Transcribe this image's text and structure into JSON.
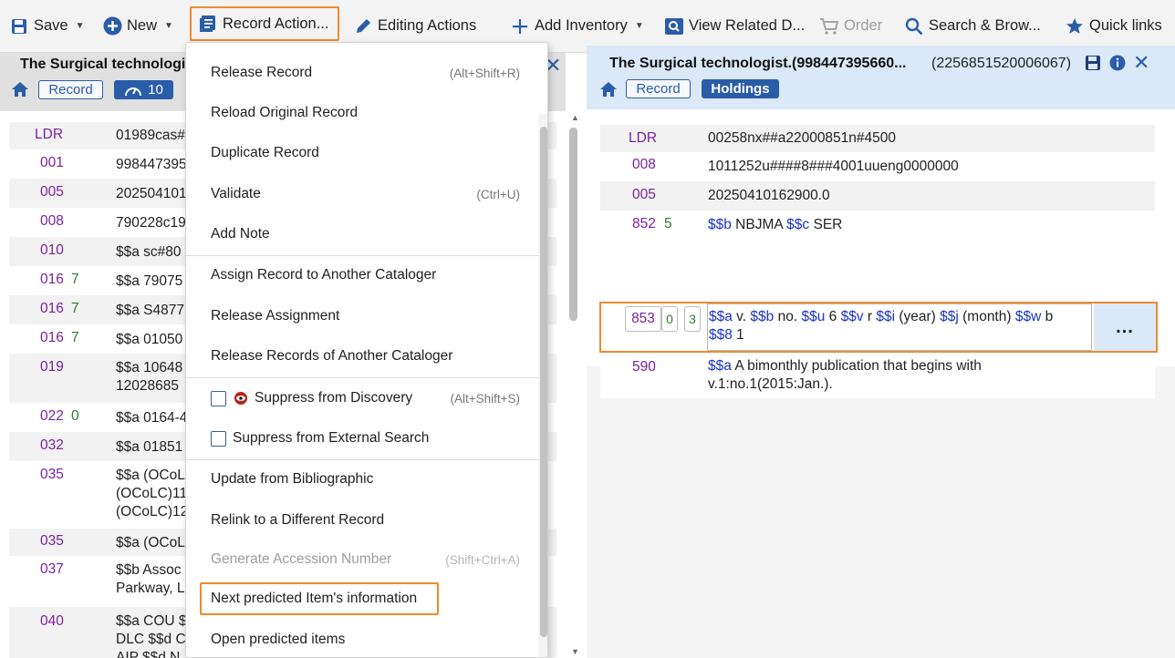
{
  "toolbar": {
    "save": "Save",
    "new": "New",
    "record_action": "Record Action...",
    "editing_actions": "Editing Actions",
    "add_inventory": "Add Inventory",
    "view_related": "View Related D...",
    "order": "Order",
    "search_browse": "Search & Brow...",
    "quick_links": "Quick links"
  },
  "left": {
    "title": "The Surgical technologis",
    "record_pill": "Record",
    "count_badge": "10",
    "fields": [
      {
        "tag": "LDR",
        "ind": "",
        "value": "01989cas#"
      },
      {
        "tag": "001",
        "ind": "",
        "value": "998447395"
      },
      {
        "tag": "005",
        "ind": "",
        "value": "202504101"
      },
      {
        "tag": "008",
        "ind": "",
        "value": "790228c19"
      },
      {
        "tag": "010",
        "ind": "",
        "value": "$$a sc#80"
      },
      {
        "tag": "016",
        "ind": "7",
        "value": "$$a 79075"
      },
      {
        "tag": "016",
        "ind": "7",
        "value": "$$a S4877"
      },
      {
        "tag": "016",
        "ind": "7",
        "value": "$$a 01050"
      },
      {
        "tag": "019",
        "ind": "",
        "value": "$$a 10648",
        "value2": "12028685"
      },
      {
        "tag": "022",
        "ind": "0",
        "value": "$$a 0164-4"
      },
      {
        "tag": "032",
        "ind": "",
        "value": "$$a 01851"
      },
      {
        "tag": "035",
        "ind": "",
        "value": "$$a (OCoL",
        "value2": "(OCoLC)11",
        "value3": "(OCoLC)12"
      },
      {
        "tag": "035",
        "ind": "",
        "value": "$$a (OCoL"
      },
      {
        "tag": "037",
        "ind": "",
        "value": "$$b Assoc",
        "value2": "Parkway, L"
      },
      {
        "tag": "040",
        "ind": "",
        "value": "$$a COU $",
        "value2": "DLC $$d C",
        "value3": "AIP $$d N"
      }
    ]
  },
  "menu": {
    "items": [
      {
        "label": "Release Record",
        "shortcut": "(Alt+Shift+R)"
      },
      {
        "label": "Reload Original Record",
        "shortcut": ""
      },
      {
        "label": "Duplicate Record",
        "shortcut": ""
      },
      {
        "label": "Validate",
        "shortcut": "(Ctrl+U)"
      },
      {
        "label": "Add Note",
        "shortcut": ""
      },
      {
        "label": "Assign Record to Another Cataloger",
        "shortcut": ""
      },
      {
        "label": "Release Assignment",
        "shortcut": ""
      },
      {
        "label": "Release Records of Another Cataloger",
        "shortcut": ""
      },
      {
        "label": "Suppress from Discovery",
        "shortcut": "(Alt+Shift+S)"
      },
      {
        "label": "Suppress from External Search",
        "shortcut": ""
      },
      {
        "label": "Update from Bibliographic",
        "shortcut": ""
      },
      {
        "label": "Relink to a Different Record",
        "shortcut": ""
      },
      {
        "label": "Generate Accession Number",
        "shortcut": "(Shift+Ctrl+A)"
      },
      {
        "label": "Next predicted Item's information",
        "shortcut": ""
      },
      {
        "label": "Open predicted items",
        "shortcut": ""
      }
    ]
  },
  "right": {
    "title": "The Surgical technologist.(998447395660...",
    "id": "(2256851520006067)",
    "record_pill": "Record",
    "holdings_pill": "Holdings",
    "fields": [
      {
        "tag": "LDR",
        "value": "00258nx##a22000851n#4500"
      },
      {
        "tag": "008",
        "value": "1011252u####8###4001uueng0000000"
      },
      {
        "tag": "005",
        "value": "20250410162900.0"
      },
      {
        "tag": "852",
        "ind": "5",
        "p1": "$$b",
        "t1": " NBJMA ",
        "p2": "$$c",
        "t2": " SER"
      }
    ],
    "edit": {
      "tag": "853",
      "ind1": "0",
      "ind2": "3",
      "s_a": "$$a",
      "t_a": " v. ",
      "s_b": "$$b",
      "t_b": " no. ",
      "s_u": "$$u",
      "t_u": " 6 ",
      "s_v": "$$v",
      "t_v": " r ",
      "s_i": "$$i",
      "t_i": " (year) ",
      "s_j": "$$j",
      "t_j": " (month) ",
      "s_w": "$$w",
      "t_w": " b",
      "s_8": "$$8",
      "t_8": " 1",
      "more": "..."
    },
    "note": {
      "tag": "590",
      "sf": "$$a",
      "line1": " A bimonthly publication that begins with",
      "line2": "v.1:no.1(2015:Jan.)."
    }
  },
  "colors": {
    "accent_orange": "#f08a2e",
    "link_blue": "#2a5da8",
    "tag_purple": "#7b1fa2",
    "indicator_green": "#2e7d32",
    "subfield_blue": "#1a35c9"
  }
}
